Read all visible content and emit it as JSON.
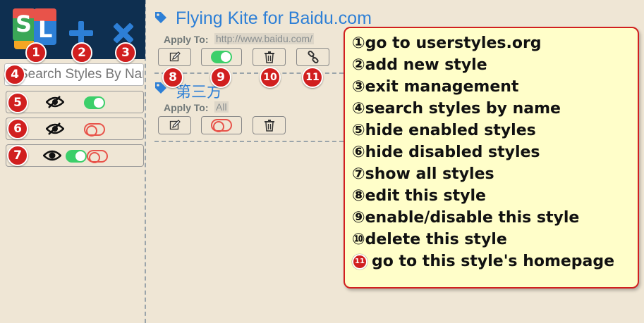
{
  "sidebar": {
    "search_placeholder": "Search Styles By Name",
    "logo_letters": [
      "S",
      "L"
    ]
  },
  "styles": [
    {
      "title": "Flying Kite for Baidu.com",
      "apply_label": "Apply To:",
      "apply_value": "http://www.baidu.com/",
      "enabled": true,
      "has_homepage": true
    },
    {
      "title": "第三方",
      "apply_label": "Apply To:",
      "apply_value": "All",
      "enabled": false,
      "has_homepage": false
    }
  ],
  "badges": [
    "1",
    "2",
    "3",
    "4",
    "5",
    "6",
    "7",
    "8",
    "9",
    "10",
    "11"
  ],
  "callout": {
    "lines": [
      {
        "num": "①",
        "text": "go to userstyles.org"
      },
      {
        "num": "②",
        "text": "add new style"
      },
      {
        "num": "③",
        "text": "exit management"
      },
      {
        "num": "④",
        "text": "search styles by name"
      },
      {
        "num": "⑤",
        "text": "hide enabled styles"
      },
      {
        "num": "⑥",
        "text": "hide disabled styles"
      },
      {
        "num": "⑦",
        "text": "show all styles"
      },
      {
        "num": "⑧",
        "text": "edit this style"
      },
      {
        "num": "⑨",
        "text": "enable/disable this style"
      },
      {
        "num": "⑩",
        "text": "delete this style"
      },
      {
        "num": "11",
        "text": " go to this style's homepage"
      }
    ]
  },
  "colors": {
    "background": "#efe6d5",
    "topbar": "#0e2f50",
    "accent_blue": "#2d7fd6",
    "toggle_on": "#3ccf6a",
    "toggle_off": "#e8534a",
    "badge_red": "#d11f1f",
    "callout_bg": "#fffec9"
  },
  "icons": {
    "logo": "stylish-logo-icon",
    "add": "plus-icon",
    "exit": "close-icon",
    "hide": "eye-slash-icon",
    "show": "eye-icon",
    "edit": "pencil-icon",
    "delete": "trash-icon",
    "homepage": "link-icon",
    "style": "tag-icon"
  }
}
